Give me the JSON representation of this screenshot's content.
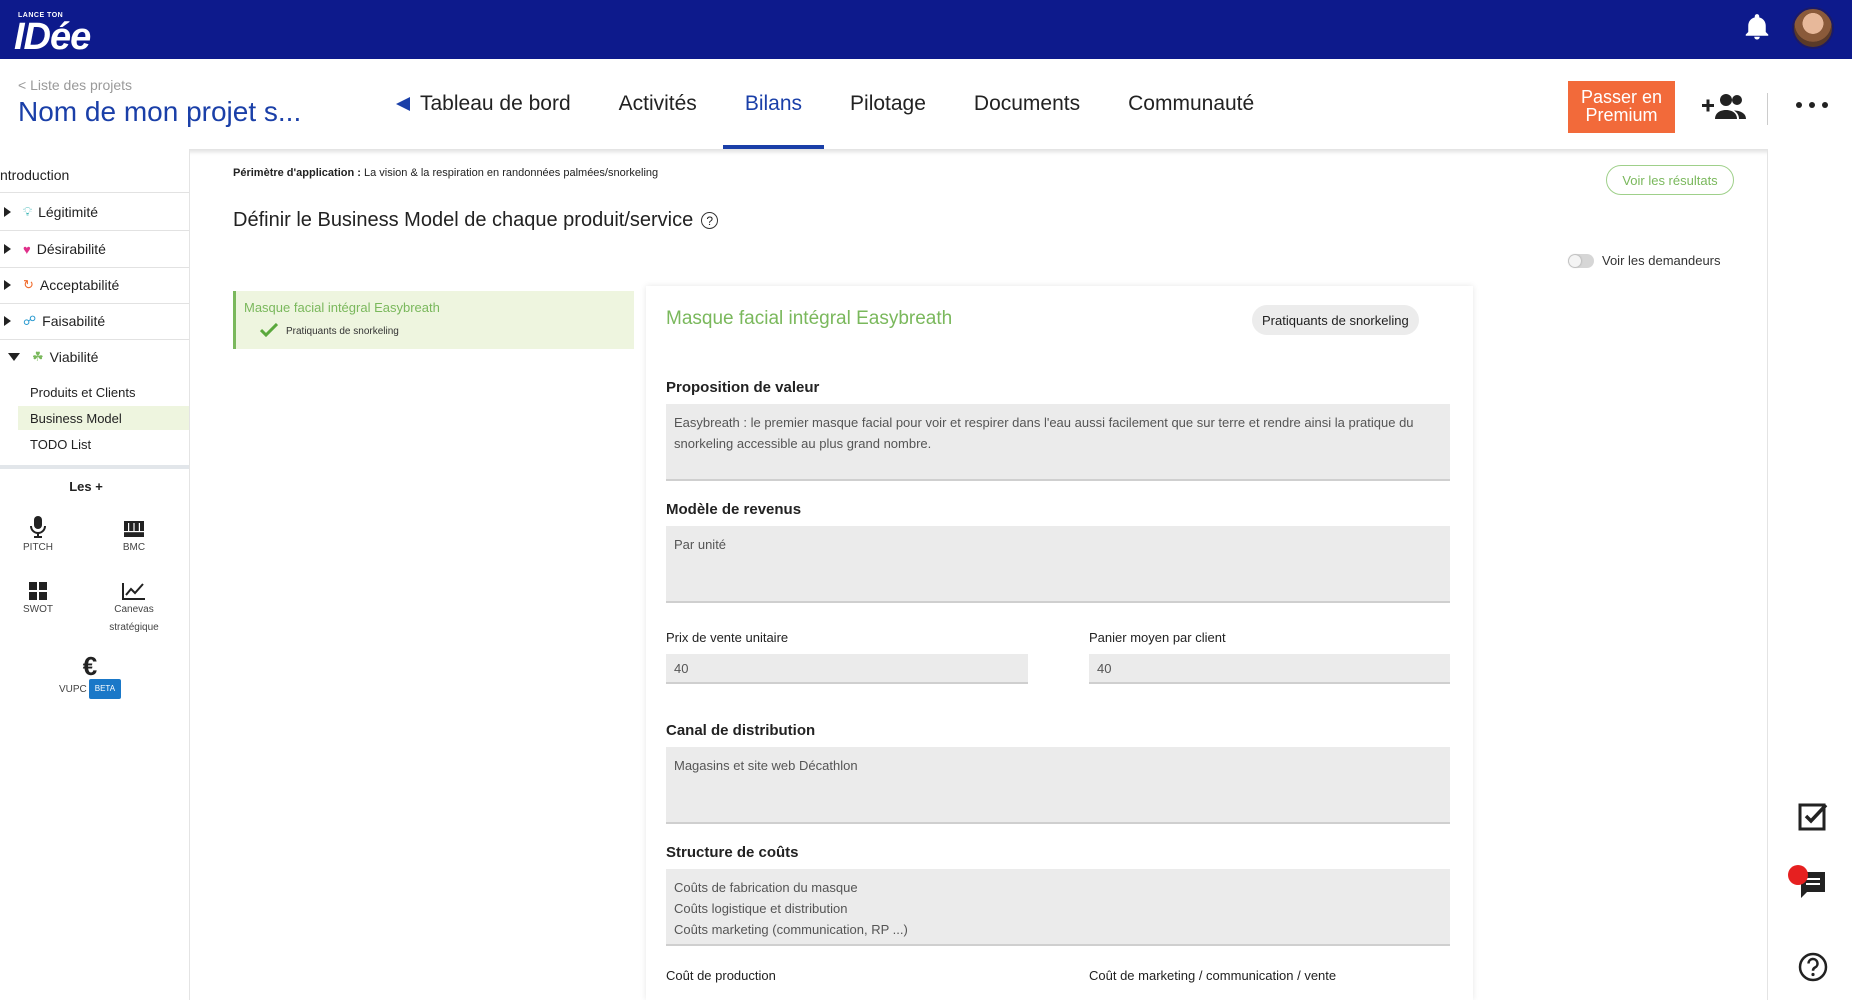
{
  "app": {
    "logo_small": "LANCE TON",
    "logo_big": "IDée"
  },
  "header": {
    "breadcrumb": "< Liste des projets",
    "project_title": "Nom de mon projet s...",
    "tabs": [
      {
        "label": "Tableau de bord"
      },
      {
        "label": "Activités"
      },
      {
        "label": "Bilans"
      },
      {
        "label": "Pilotage"
      },
      {
        "label": "Documents"
      },
      {
        "label": "Communauté"
      }
    ],
    "active_tab": "Bilans",
    "premium_label": "Passer en Premium"
  },
  "sidebar": {
    "intro": "ntroduction",
    "items": [
      {
        "label": "Légitimité",
        "icon": "lightbulb-icon",
        "color": "#3fb6b6"
      },
      {
        "label": "Désirabilité",
        "icon": "heart-icon",
        "color": "#e0308a"
      },
      {
        "label": "Acceptabilité",
        "icon": "cycle-icon",
        "color": "#f06a2a"
      },
      {
        "label": "Faisabilité",
        "icon": "link-icon",
        "color": "#2a9ad0"
      },
      {
        "label": "Viabilité",
        "icon": "sprout-icon",
        "color": "#7ab85c"
      }
    ],
    "sub_items": [
      {
        "label": "Produits et Clients"
      },
      {
        "label": "Business Model"
      },
      {
        "label": "TODO List"
      }
    ],
    "les_plus": "Les +",
    "tools": [
      {
        "label": "PITCH",
        "icon": "microphone-icon"
      },
      {
        "label": "BMC",
        "icon": "grid-board-icon"
      },
      {
        "label": "SWOT",
        "icon": "four-squares-icon"
      },
      {
        "label": "Canevas stratégique",
        "icon": "line-chart-icon"
      },
      {
        "label": "VUPC",
        "icon": "euro-icon",
        "badge": "BETA"
      }
    ]
  },
  "main": {
    "perimetre_label": "Périmètre d'application :",
    "perimetre_value": "La vision & la respiration en randonnées palmées/snorkeling",
    "results_button": "Voir les résultats",
    "section_title": "Définir le Business Model de chaque produit/service",
    "toggle_label": "Voir les demandeurs",
    "product": {
      "name": "Masque facial intégral Easybreath",
      "segment": "Pratiquants de snorkeling"
    },
    "form": {
      "title": "Masque facial intégral Easybreath",
      "chip": "Pratiquants de snorkeling",
      "value_prop_label": "Proposition de valeur",
      "value_prop": "Easybreath : le premier masque facial pour voir et respirer dans l'eau aussi facilement que sur terre et rendre ainsi la pratique du snorkeling accessible au plus grand nombre.",
      "revenue_label": "Modèle de revenus",
      "revenue": "Par unité",
      "price_label": "Prix de vente unitaire",
      "price": "40",
      "basket_label": "Panier moyen par client",
      "basket": "40",
      "channel_label": "Canal de distribution",
      "channel": "Magasins et site web Décathlon",
      "costs_label": "Structure de coûts",
      "costs": "Coûts de fabrication du masque\nCoûts logistique et distribution\nCoûts marketing (communication, RP ...)",
      "prod_cost_label": "Coût de production",
      "mkt_cost_label": "Coût de marketing / communication / vente"
    }
  },
  "colors": {
    "brand_blue": "#0d1a8c",
    "accent_blue": "#1a3fa8",
    "accent_green": "#7ab85c",
    "premium_orange": "#f26a3a"
  }
}
